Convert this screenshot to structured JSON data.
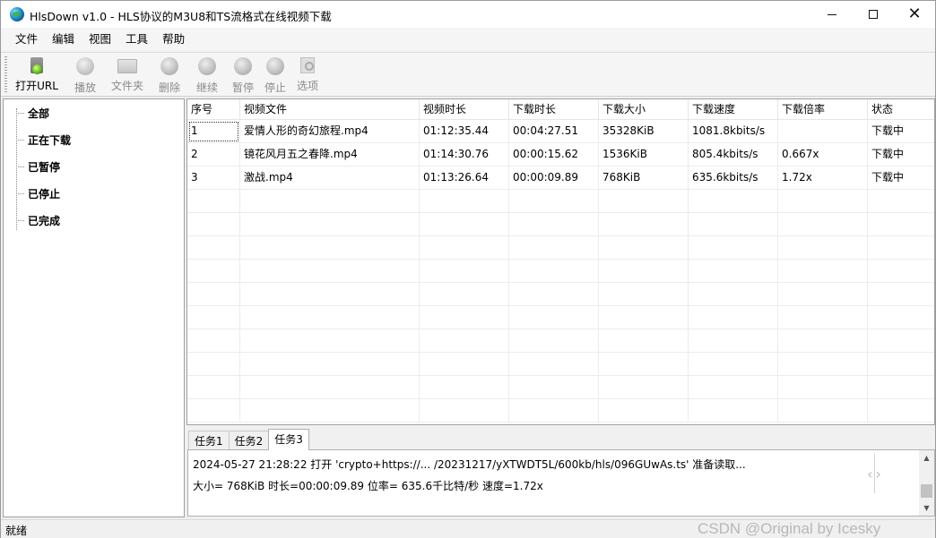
{
  "window": {
    "title": "HlsDown v1.0 - HLS协议的M3U8和TS流格式在线视频下载"
  },
  "menu": [
    "文件",
    "编辑",
    "视图",
    "工具",
    "帮助"
  ],
  "toolbar": [
    {
      "label": "打开URL",
      "icon": "open-url-icon",
      "enabled": true
    },
    {
      "label": "播放",
      "icon": "play-icon",
      "enabled": false
    },
    {
      "label": "文件夹",
      "icon": "folder-icon",
      "enabled": false
    },
    {
      "label": "删除",
      "icon": "delete-icon",
      "enabled": false
    },
    {
      "label": "继续",
      "icon": "resume-icon",
      "enabled": false
    },
    {
      "label": "暂停",
      "icon": "pause-icon",
      "enabled": false
    },
    {
      "label": "停止",
      "icon": "stop-icon",
      "enabled": false
    },
    {
      "label": "选项",
      "icon": "options-icon",
      "enabled": false
    }
  ],
  "tree": [
    "全部",
    "正在下载",
    "已暂停",
    "已停止",
    "已完成"
  ],
  "table": {
    "columns": [
      "序号",
      "视频文件",
      "视频时长",
      "下载时长",
      "下载大小",
      "下载速度",
      "下载倍率",
      "状态"
    ],
    "rows": [
      [
        "1",
        "爱情人形的奇幻旅程.mp4",
        "01:12:35.44",
        "00:04:27.51",
        "35328KiB",
        "1081.8kbits/s",
        "",
        "下载中"
      ],
      [
        "2",
        "镜花风月五之春降.mp4",
        "01:14:30.76",
        "00:00:15.62",
        "1536KiB",
        "805.4kbits/s",
        "0.667x",
        "下载中"
      ],
      [
        "3",
        "激战.mp4",
        "01:13:26.64",
        "00:00:09.89",
        "768KiB",
        "635.6kbits/s",
        "1.72x",
        "下载中"
      ]
    ]
  },
  "log": {
    "tabs": [
      "任务1",
      "任务2",
      "任务3"
    ],
    "active_tab": 2,
    "lines": [
      "2024-05-27 21:28:22 打开 'crypto+https://... /20231217/yXTWDT5L/600kb/hls/096GUwAs.ts' 准备读取...",
      "大小=     768KiB 时长=00:00:09.89 位率= 635.6千比特/秒 速度=1.72x"
    ]
  },
  "status": {
    "text": "就绪",
    "watermark": "CSDN @Original by Icesky"
  }
}
